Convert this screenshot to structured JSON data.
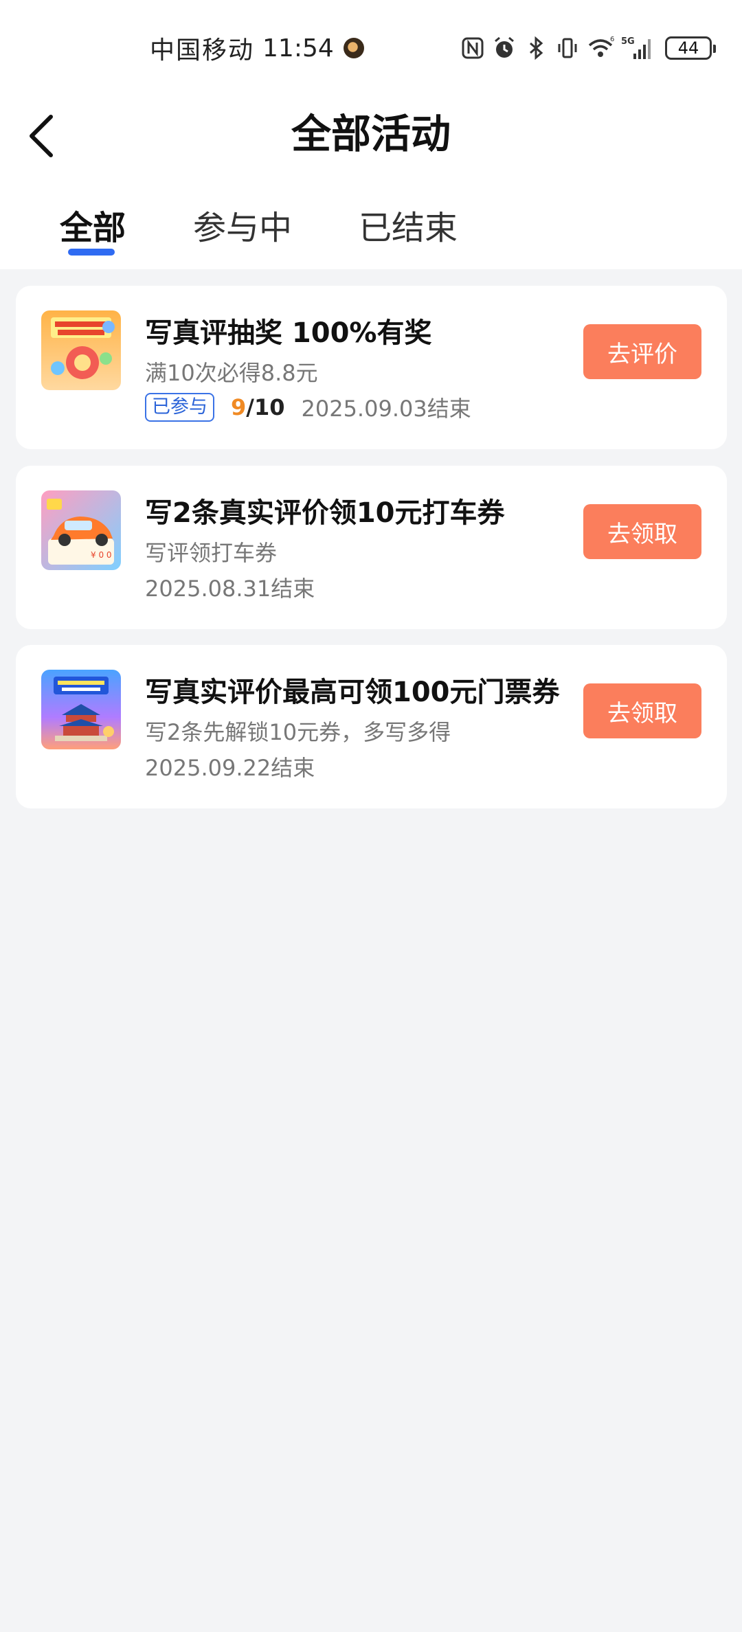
{
  "status_bar": {
    "carrier": "中国移动",
    "time": "11:54",
    "signal_label": "5G",
    "signal_sup": "6",
    "battery": "44"
  },
  "header": {
    "title": "全部活动"
  },
  "tabs": [
    {
      "label": "全部",
      "active": true
    },
    {
      "label": "参与中",
      "active": false
    },
    {
      "label": "已结束",
      "active": false
    }
  ],
  "activities": [
    {
      "title": "写真评抽奖 100%有奖",
      "subtitle": "满10次必得8.8元",
      "badge": "已参与",
      "progress_current": "9",
      "progress_total": "/10",
      "end_date": "2025.09.03结束",
      "button": "去评价",
      "thumb_icon": "lottery-banner-image"
    },
    {
      "title": "写2条真实评价领10元打车券",
      "subtitle": "写评领打车券",
      "end_date": "2025.08.31结束",
      "button": "去领取",
      "thumb_icon": "car-coupon-image"
    },
    {
      "title": "写真实评价最高可领100元门票券",
      "subtitle": "写2条先解锁10元券，多写多得",
      "end_date": "2025.09.22结束",
      "button": "去领取",
      "thumb_icon": "ticket-coupon-image"
    }
  ],
  "colors": {
    "accent": "#2f6bf2",
    "button": "#fb7e5c",
    "progress_highlight": "#f08a24",
    "background": "#f3f4f6"
  }
}
